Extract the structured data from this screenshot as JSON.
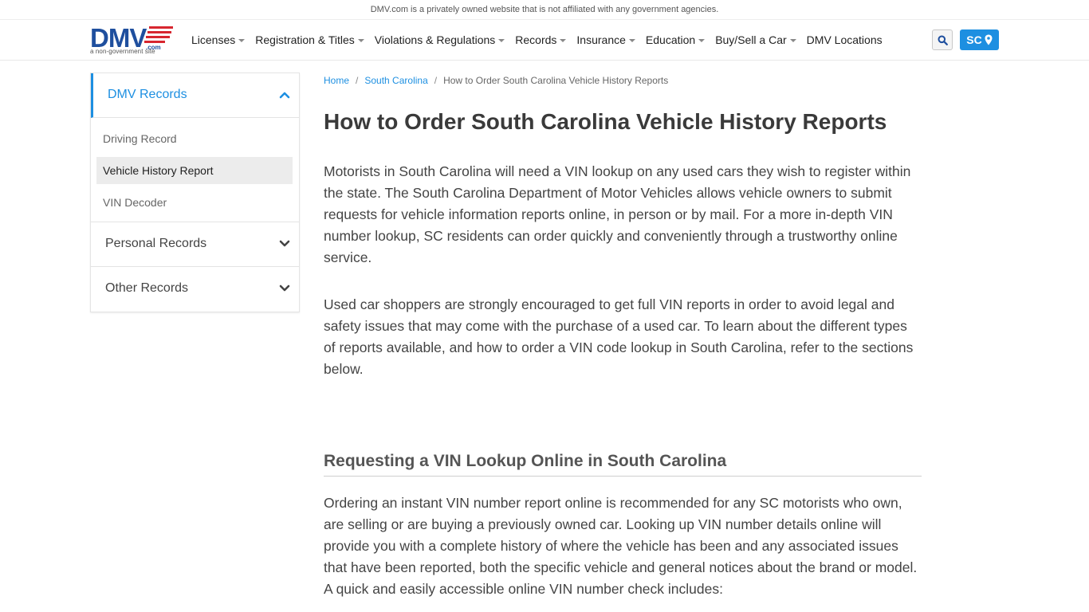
{
  "disclaimer": "DMV.com is a privately owned website that is not affiliated with any government agencies.",
  "logo": {
    "text": "DMV",
    "dotcom": ".com",
    "tagline": "a non-government site"
  },
  "nav": {
    "items": [
      {
        "label": "Licenses",
        "dropdown": true
      },
      {
        "label": "Registration & Titles",
        "dropdown": true
      },
      {
        "label": "Violations & Regulations",
        "dropdown": true
      },
      {
        "label": "Records",
        "dropdown": true
      },
      {
        "label": "Insurance",
        "dropdown": true
      },
      {
        "label": "Education",
        "dropdown": true
      },
      {
        "label": "Buy/Sell a Car",
        "dropdown": true
      },
      {
        "label": "DMV Locations",
        "dropdown": false
      }
    ],
    "state_label": "SC"
  },
  "sidebar": {
    "sections": [
      {
        "title": "DMV Records",
        "expanded": true,
        "links": [
          "Driving Record",
          "Vehicle History Report",
          "VIN Decoder"
        ],
        "current": "Vehicle History Report"
      },
      {
        "title": "Personal Records",
        "expanded": false
      },
      {
        "title": "Other Records",
        "expanded": false
      }
    ]
  },
  "breadcrumb": {
    "home": "Home",
    "state": "South Carolina",
    "current": "How to Order South Carolina Vehicle History Reports"
  },
  "article": {
    "title": "How to Order South Carolina Vehicle History Reports",
    "paragraph1": "Motorists in South Carolina will need a VIN lookup on any used cars they wish to register within the state. The South Carolina Department of Motor Vehicles allows vehicle owners to submit requests for vehicle information reports online, in person or by mail. For a more in-depth VIN number lookup, SC residents can order quickly and conveniently through a trustworthy online service.",
    "paragraph2": "Used car shoppers are strongly encouraged to get full VIN reports in order to avoid legal and safety issues that may come with the purchase of a used car. To learn about the different types of reports available, and how to order a VIN code lookup in South Carolina, refer to the sections below.",
    "heading2": "Requesting a VIN Lookup Online in South Carolina",
    "paragraph3": "Ordering an instant VIN number report online is recommended for any SC motorists who own, are selling or are buying a previously owned car. Looking up VIN number details online will provide you with a complete history of where the vehicle has been and any associated issues that have been reported, both the specific vehicle and general notices about the brand or model. A quick and easily accessible online VIN number check includes:"
  },
  "colors": {
    "accent": "#1d8fe1",
    "logo_blue": "#1f4f9e",
    "logo_red": "#d7262f"
  }
}
